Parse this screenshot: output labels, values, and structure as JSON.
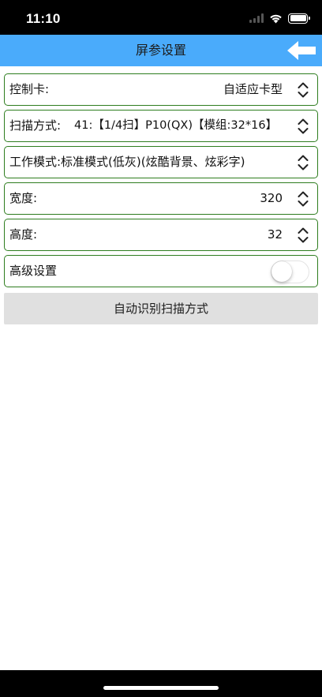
{
  "status_bar": {
    "time": "11:10"
  },
  "nav": {
    "title": "屏参设置",
    "back_icon": "arrow-left-icon"
  },
  "rows": {
    "control_card": {
      "label": "控制卡:",
      "value": "自适应卡型"
    },
    "scan_mode": {
      "label": "扫描方式:",
      "value": "41:【1/4扫】P10(QX)【模组:32*16】"
    },
    "work_mode": {
      "label": "工作模式:标准模式(低灰)(炫酷背景、炫彩字)"
    },
    "width": {
      "label": "宽度:",
      "value": "320"
    },
    "height": {
      "label": "高度:",
      "value": "32"
    },
    "advanced": {
      "label": "高级设置",
      "toggle_on": false
    }
  },
  "auto_detect_button": {
    "label": "自动识别扫描方式"
  },
  "colors": {
    "nav_background": "#4aabfb",
    "row_border": "#2e7d1f",
    "button_background": "#e0e0e0"
  }
}
